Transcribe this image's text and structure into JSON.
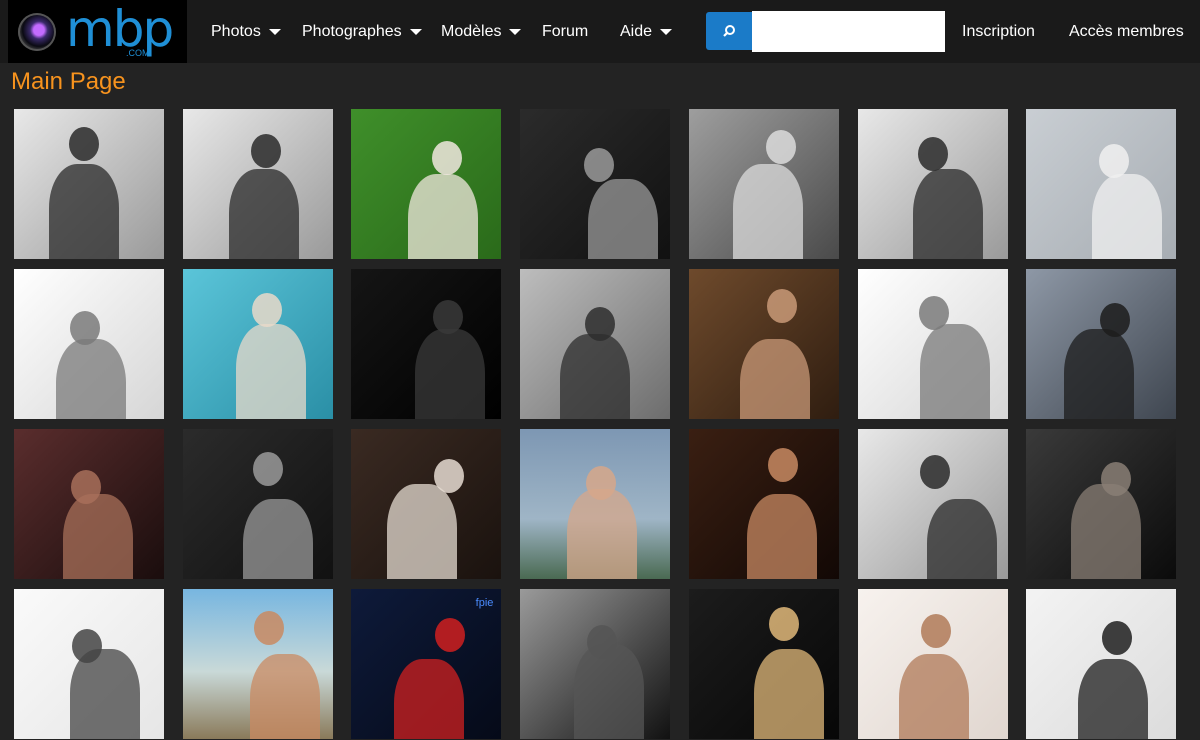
{
  "header": {
    "logo_text": "mbp",
    "logo_sub": ".COM",
    "nav": [
      {
        "label": "Photos",
        "dropdown": true
      },
      {
        "label": "Photographes",
        "dropdown": true
      },
      {
        "label": "Modèles",
        "dropdown": true
      },
      {
        "label": "Forum",
        "dropdown": false
      },
      {
        "label": "Aide",
        "dropdown": true
      }
    ],
    "search": {
      "placeholder": "",
      "value": "",
      "icon": "search-icon"
    },
    "signup_label": "Inscription",
    "members_label": "Accès membres"
  },
  "page_title": "Main Page",
  "gallery": {
    "rows": 4,
    "columns": 7,
    "tiles": [
      {
        "style": "bw-light",
        "label": ""
      },
      {
        "style": "bw-light",
        "label": ""
      },
      {
        "style": "green",
        "label": ""
      },
      {
        "style": "bw-dark",
        "label": ""
      },
      {
        "style": "bw-mid",
        "label": ""
      },
      {
        "style": "bw-light",
        "label": ""
      },
      {
        "style": "bw-pale",
        "label": ""
      },
      {
        "style": "bw-white",
        "label": ""
      },
      {
        "style": "cyan",
        "label": ""
      },
      {
        "style": "black",
        "label": ""
      },
      {
        "style": "bw-gray",
        "label": ""
      },
      {
        "style": "warm",
        "label": ""
      },
      {
        "style": "bw-white",
        "label": ""
      },
      {
        "style": "bw-blue",
        "label": ""
      },
      {
        "style": "warm-dark",
        "label": ""
      },
      {
        "style": "bw-dark",
        "label": ""
      },
      {
        "style": "sepia-dark",
        "label": ""
      },
      {
        "style": "sky",
        "label": ""
      },
      {
        "style": "brown",
        "label": ""
      },
      {
        "style": "bw-light",
        "label": ""
      },
      {
        "style": "bw-black",
        "label": ""
      },
      {
        "style": "white-smoke",
        "label": ""
      },
      {
        "style": "beach",
        "label": ""
      },
      {
        "style": "navy",
        "label": "fpie"
      },
      {
        "style": "metro",
        "label": ""
      },
      {
        "style": "dark-blond",
        "label": ""
      },
      {
        "style": "white-warm",
        "label": ""
      },
      {
        "style": "white-dark",
        "label": ""
      }
    ]
  }
}
